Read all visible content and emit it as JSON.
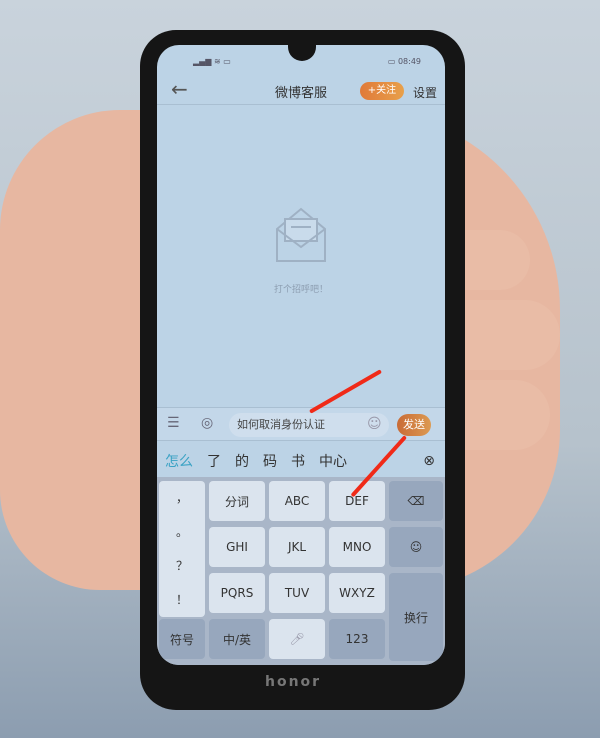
{
  "status": {
    "time": "08:49"
  },
  "header": {
    "back_icon": "arrow-left-icon",
    "title": "微博客服",
    "follow": "+关注",
    "settings": "设置"
  },
  "empty": {
    "icon": "envelope-icon",
    "text": "打个招呼吧！"
  },
  "input": {
    "value": "如何取消身份认证",
    "send": "发送"
  },
  "candidates": [
    "怎么",
    "了",
    "的",
    "码",
    "书",
    "中心"
  ],
  "keyboard": {
    "punct": [
      "，",
      "。",
      "？",
      "！"
    ],
    "rows": [
      [
        "分词",
        "ABC",
        "DEF"
      ],
      [
        "GHI",
        "JKL",
        "MNO"
      ],
      [
        "PQRS",
        "TUV",
        "WXYZ"
      ]
    ],
    "symbol": "符号",
    "lang": "中/英",
    "num": "123",
    "enter": "换行"
  },
  "brand": "honor",
  "colors": {
    "accent": "#e07a3a",
    "annotation_arrow": "#f02a18"
  }
}
